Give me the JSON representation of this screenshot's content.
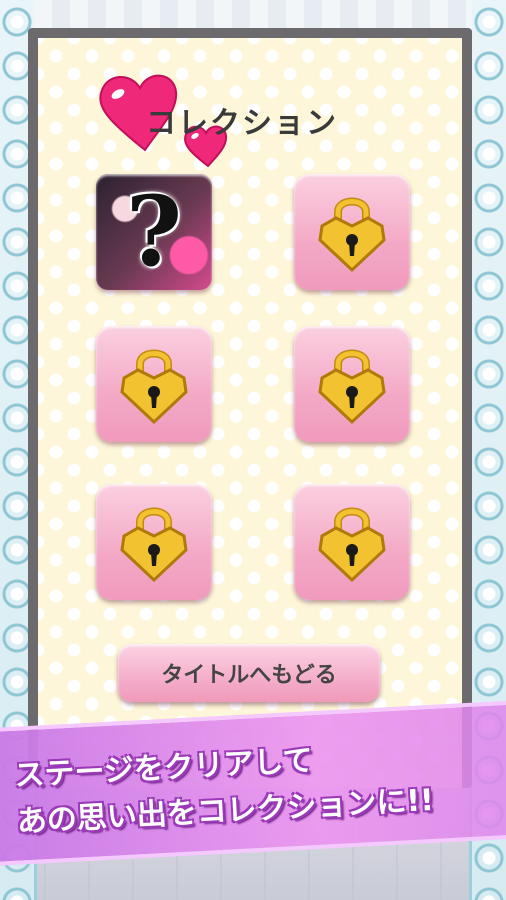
{
  "screen": {
    "title": "コレクション",
    "back_button_label": "タイトルへもどる"
  },
  "collection": {
    "items": [
      {
        "state": "unlocked",
        "symbol": "?"
      },
      {
        "state": "locked"
      },
      {
        "state": "locked"
      },
      {
        "state": "locked"
      },
      {
        "state": "locked"
      },
      {
        "state": "locked"
      }
    ]
  },
  "banner": {
    "line1": "ステージをクリアして",
    "line2": "あの思い出をコレクションに!!"
  },
  "colors": {
    "accent_pink": "#f3a9c6",
    "heart_pink": "#f0287a",
    "lock_gold": "#f2c230",
    "banner_purple": "#d28be8"
  },
  "icons": {
    "lock": "heart-lock-icon",
    "title_decoration": "hearts-icon"
  }
}
